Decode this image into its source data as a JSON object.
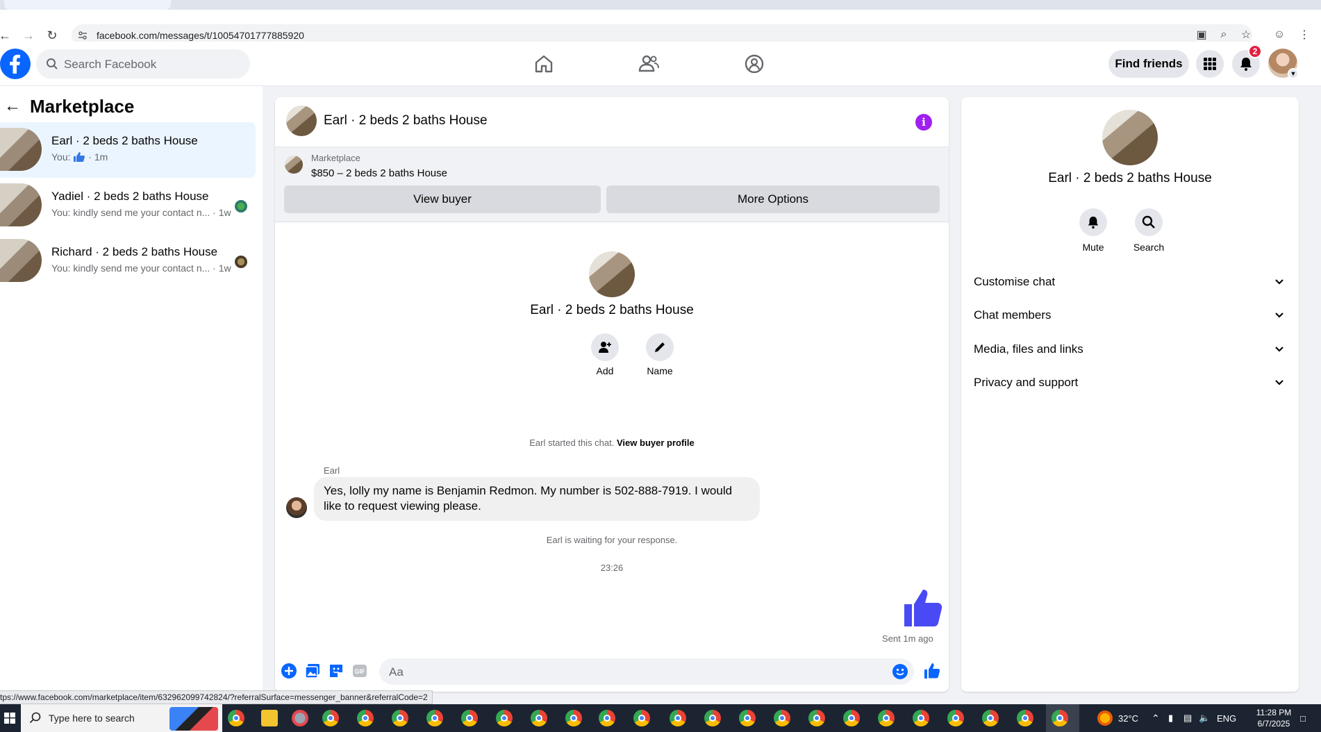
{
  "browser": {
    "url": "facebook.com/messages/t/10054701777885920",
    "status_url": "tps://www.facebook.com/marketplace/item/632962099742824/?referralSurface=messenger_banner&referralCode=2"
  },
  "header": {
    "search_placeholder": "Search Facebook",
    "find_friends": "Find friends",
    "notification_count": "2",
    "brand_color": "#0866ff"
  },
  "left": {
    "title": "Marketplace",
    "conversations": [
      {
        "name": "Earl · 2 beds 2 baths House",
        "preview": "You: ",
        "time": " · 1m"
      },
      {
        "name": "Yadiel · 2 beds 2 baths House",
        "preview": "You: kindly send me your contact n... · 1w"
      },
      {
        "name": "Richard · 2 beds 2 baths House",
        "preview": "You: kindly send me your contact n... · 1w"
      }
    ]
  },
  "chat": {
    "title": "Earl · 2 beds 2 baths House",
    "listing_source": "Marketplace",
    "listing_price": "$850 – 2 beds 2 baths House",
    "view_buyer": "View buyer",
    "more_options": "More Options",
    "profile_name": "Earl · 2 beds 2 baths House",
    "add_label": "Add",
    "name_label": "Name",
    "started_text": "Earl started this chat.",
    "view_buyer_profile": "View buyer profile",
    "sender": "Earl",
    "message": "Yes, lolly my name is Benjamin Redmon. My number is 502-888-7919. I would like to request viewing please.",
    "waiting": "Earl is waiting for your response.",
    "timestamp": "23:26",
    "sent": "Sent 1m ago",
    "composer_placeholder": "Aa",
    "accent_color": "#4a4af4"
  },
  "right": {
    "name": "Earl · 2 beds 2 baths House",
    "mute": "Mute",
    "search": "Search",
    "sections": [
      "Customise chat",
      "Chat members",
      "Media, files and links",
      "Privacy and support"
    ]
  },
  "taskbar": {
    "search_placeholder": "Type here to search",
    "temperature": "32°C",
    "language": "ENG",
    "time": "11:28 PM",
    "date": "6/7/2025"
  }
}
